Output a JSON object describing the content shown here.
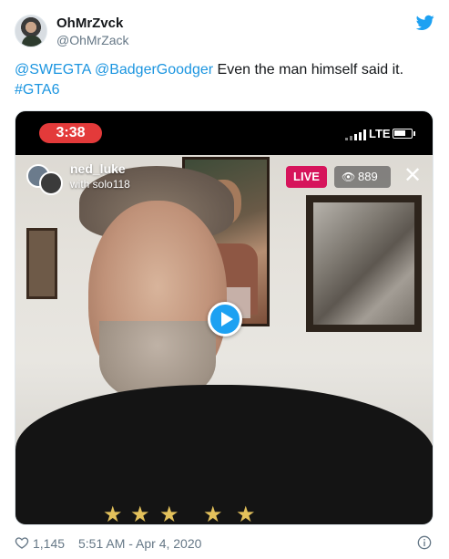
{
  "tweet": {
    "display_name": "OhMrZvck",
    "handle": "@OhMrZack",
    "text_parts": [
      {
        "text": "@SWEGTA",
        "link": true
      },
      {
        "text": " ",
        "link": false
      },
      {
        "text": "@BadgerGoodger",
        "link": true
      },
      {
        "text": " Even the man himself said it.",
        "link": false
      },
      {
        "text": "#GTA6",
        "link": true
      }
    ],
    "likes": "1,145",
    "timestamp": "5:51 AM - Apr 4, 2020"
  },
  "video": {
    "status_time": "3:38",
    "network": "LTE",
    "battery_level": 0.7,
    "host_name": "ned_luke",
    "host_with": "with solo118",
    "live_label": "LIVE",
    "viewer_count": "889",
    "close_glyph": "✕"
  },
  "icons": {
    "twitter": "twitter-bird-icon",
    "play": "play-icon",
    "heart": "heart-icon",
    "info": "info-icon",
    "eye": "eye-icon"
  },
  "colors": {
    "link": "#1b95e0",
    "twitter_blue": "#1da1f2",
    "live_badge": "#d6145b",
    "timer_red": "#e33a3a",
    "meta_gray": "#657786"
  }
}
